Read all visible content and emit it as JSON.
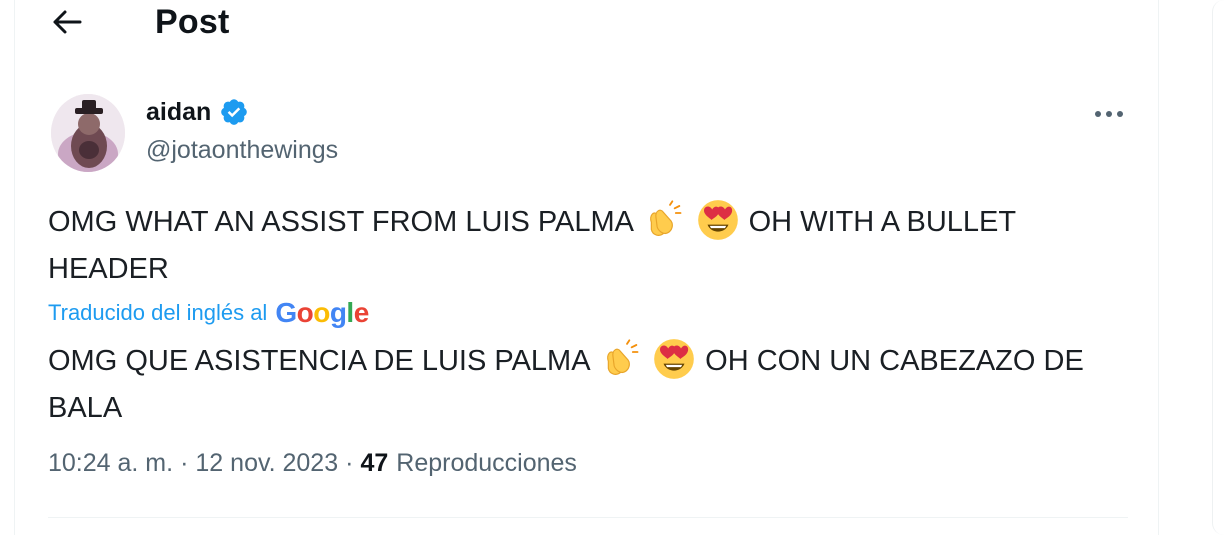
{
  "header": {
    "title": "Post"
  },
  "author": {
    "display_name": "aidan",
    "handle": "@jotaonthewings",
    "verified": true
  },
  "tweet": {
    "text_part1": "OMG WHAT AN ASSIST FROM LUIS PALMA",
    "text_part2": "OH WITH A BULLET HEADER",
    "emojis": [
      "clapping-hands-emoji",
      "heart-eyes-emoji"
    ]
  },
  "translation": {
    "label": "Traducido del inglés al",
    "provider": "Google",
    "provider_letters": [
      "G",
      "o",
      "o",
      "g",
      "l",
      "e"
    ],
    "provider_colors": [
      "#4285F4",
      "#EA4335",
      "#FBBC05",
      "#4285F4",
      "#34A853",
      "#EA4335"
    ],
    "text_part1": "OMG QUE ASISTENCIA DE LUIS PALMA",
    "text_part2": "OH CON UN CABEZAZO DE BALA"
  },
  "meta": {
    "time": "10:24 a. m.",
    "separator": "·",
    "date": "12 nov. 2023",
    "views_count": "47",
    "views_label": "Reproducciones"
  },
  "colors": {
    "accent": "#1d9bf0",
    "secondary_text": "#536471",
    "primary_text": "#0f1419"
  }
}
